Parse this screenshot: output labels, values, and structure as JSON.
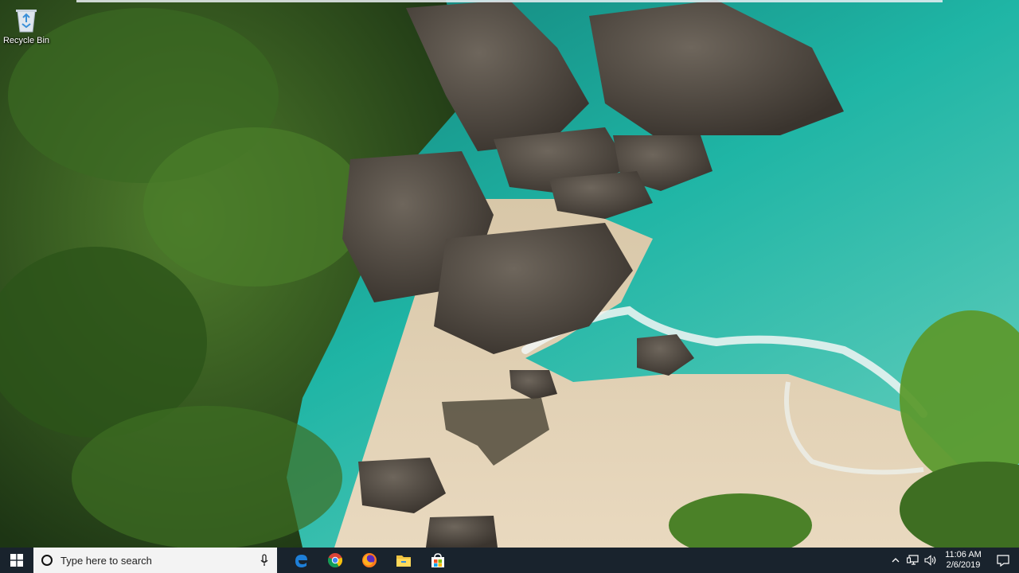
{
  "desktop": {
    "icons": [
      {
        "label": "Recycle Bin",
        "icon": "recycle-bin-icon"
      }
    ]
  },
  "taskbar": {
    "start_icon": "windows-logo-icon",
    "search": {
      "placeholder": "Type here to search",
      "icon": "cortana-circle-icon",
      "mic_icon": "microphone-icon"
    },
    "pinned": [
      {
        "name": "Microsoft Edge",
        "icon": "edge-icon"
      },
      {
        "name": "Google Chrome",
        "icon": "chrome-icon"
      },
      {
        "name": "Firefox",
        "icon": "firefox-icon"
      },
      {
        "name": "File Explorer",
        "icon": "file-explorer-icon"
      },
      {
        "name": "Microsoft Store",
        "icon": "store-icon"
      }
    ],
    "tray": {
      "time": "11:06 AM",
      "date": "2/6/2019",
      "icons": [
        "chevron-up-icon",
        "network-icon",
        "volume-icon"
      ],
      "notification_icon": "action-center-icon"
    }
  },
  "colors": {
    "taskbar_bg": "#19232d",
    "search_bg": "#f3f3f3",
    "edge_blue": "#1e7fd8"
  }
}
